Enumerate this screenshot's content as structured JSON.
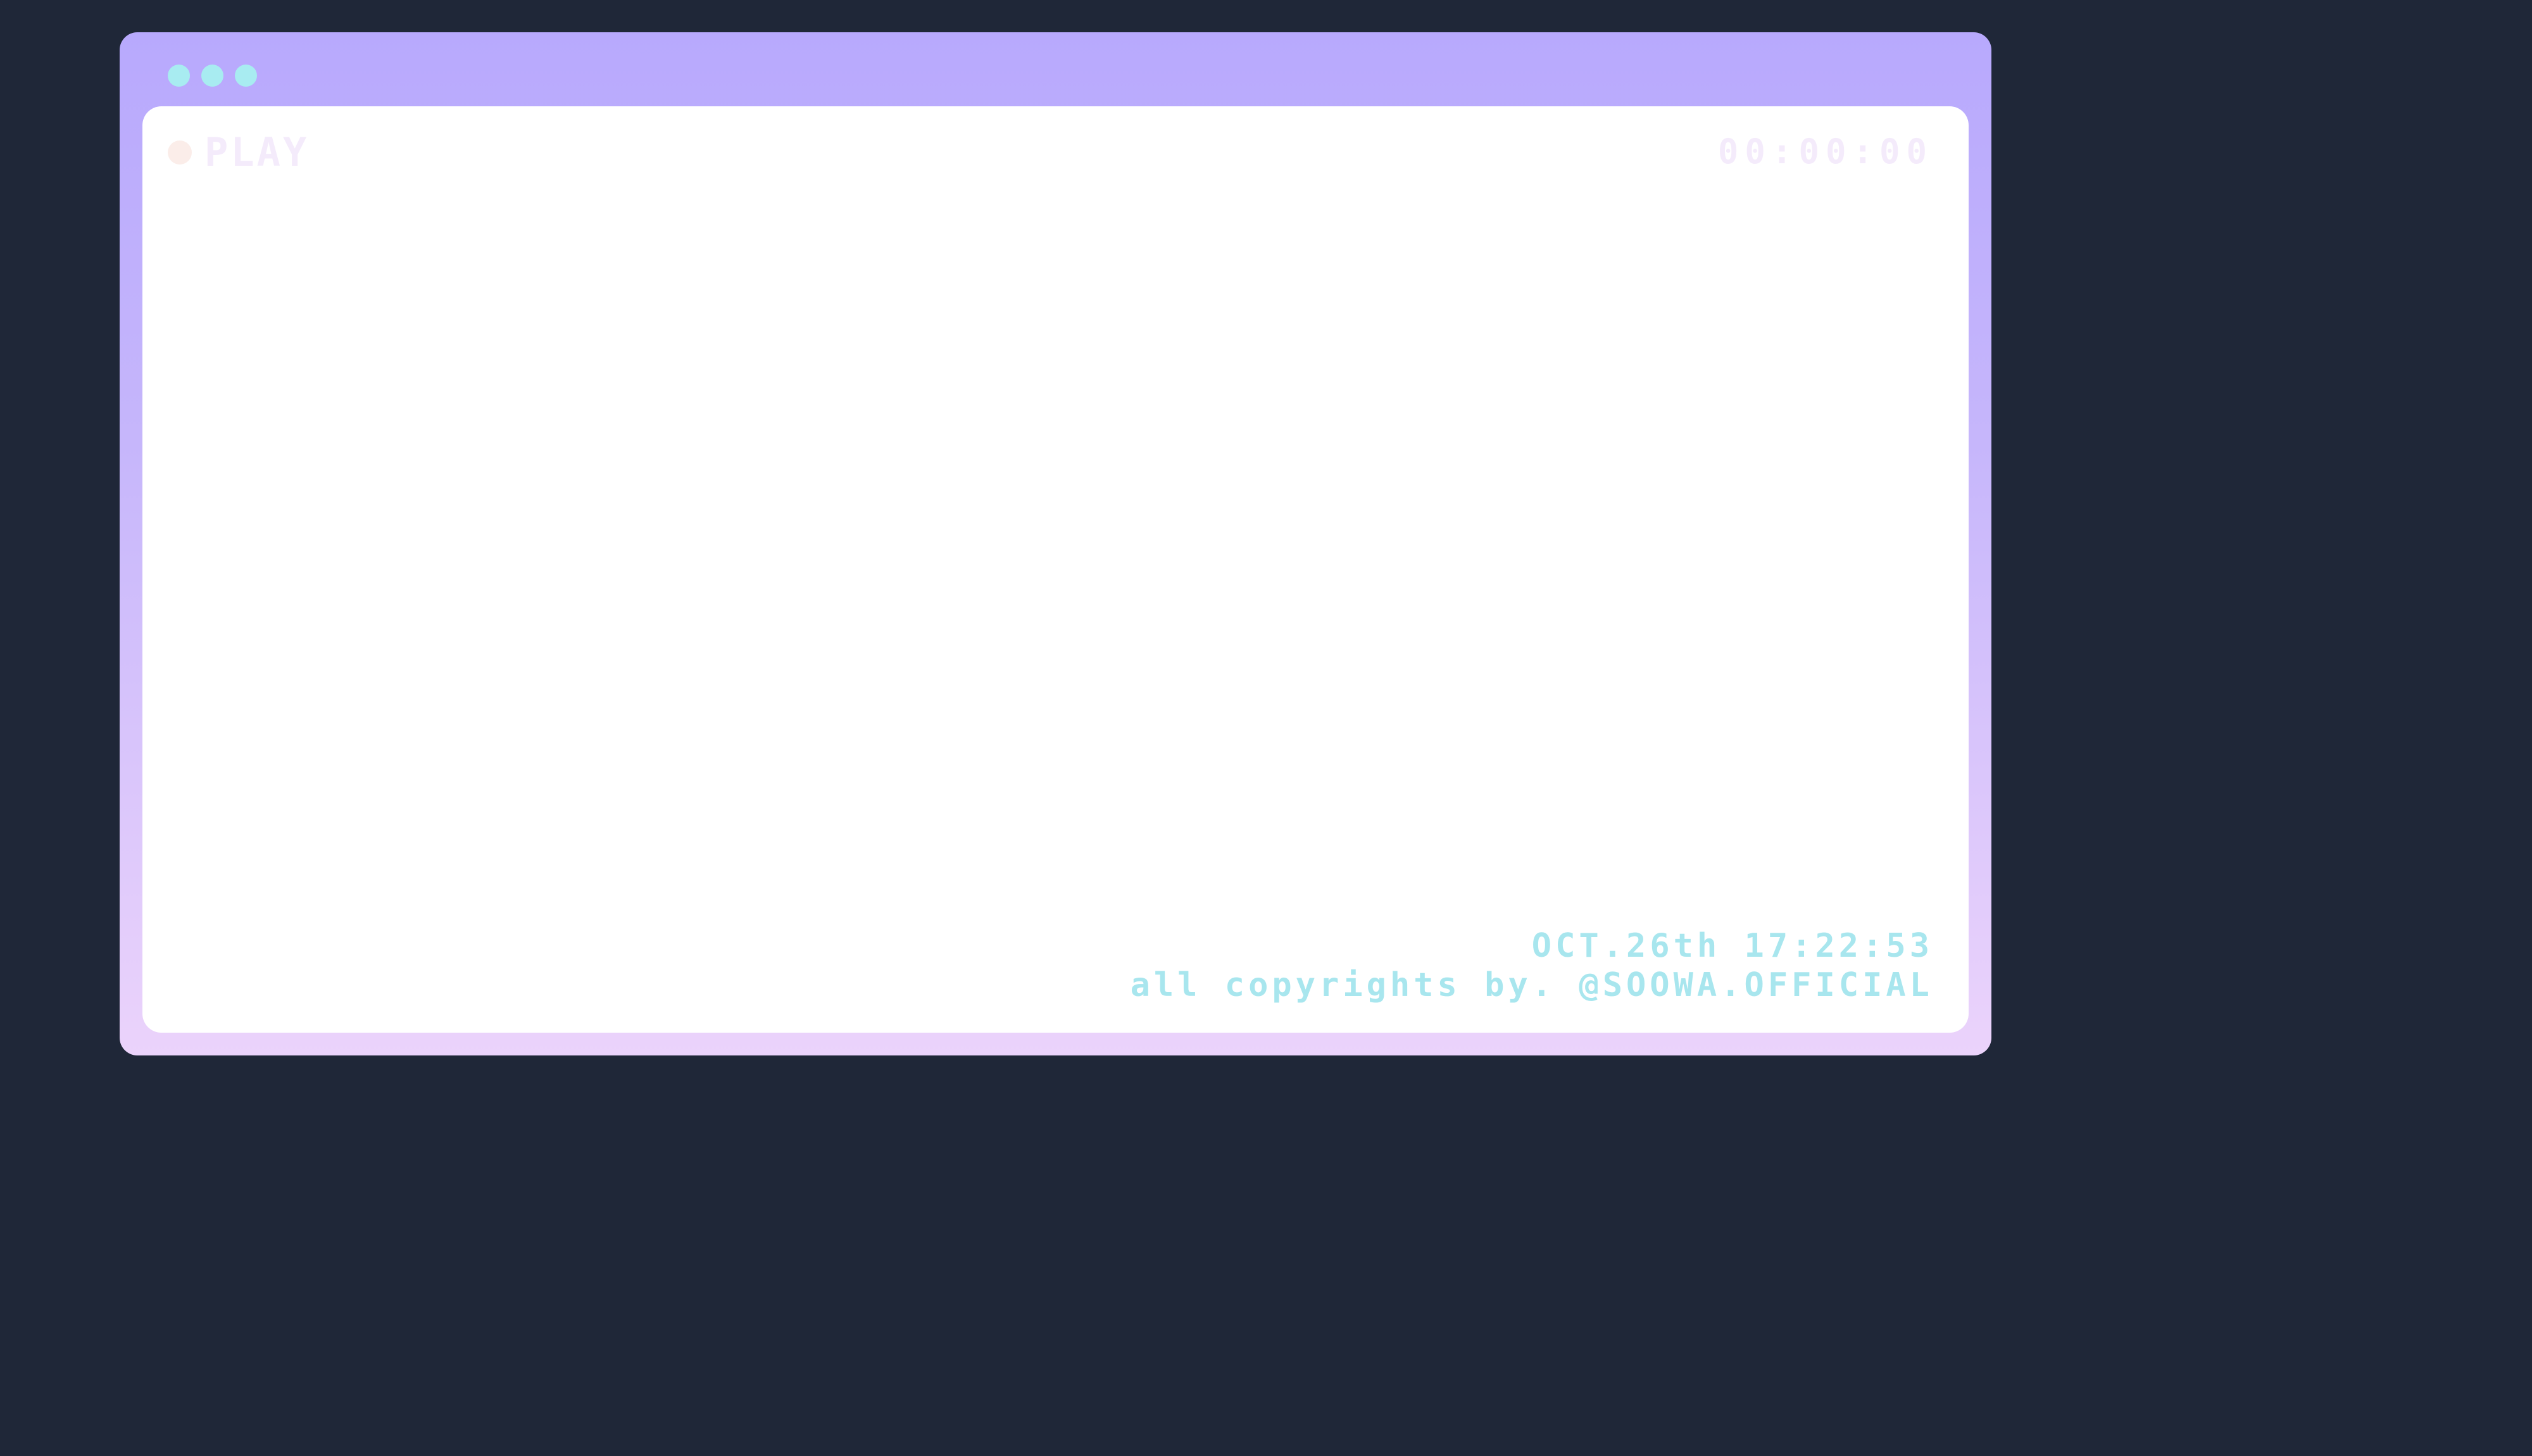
{
  "window": {
    "frame_gradient_top": "#b8a9fd",
    "frame_gradient_bottom": "#ebd3fb",
    "titlebar_dot_color": "#a8ecf1",
    "titlebar_dots": [
      "dot",
      "dot",
      "dot"
    ]
  },
  "screen": {
    "status": {
      "indicator_color": "#fbede9",
      "label": "PLAY"
    },
    "timecode": "00:00:00",
    "footer": {
      "date_time": "OCT.26th 17:22:53",
      "copyright": "all copyrights by. @SOOWA.OFFICIAL"
    }
  }
}
